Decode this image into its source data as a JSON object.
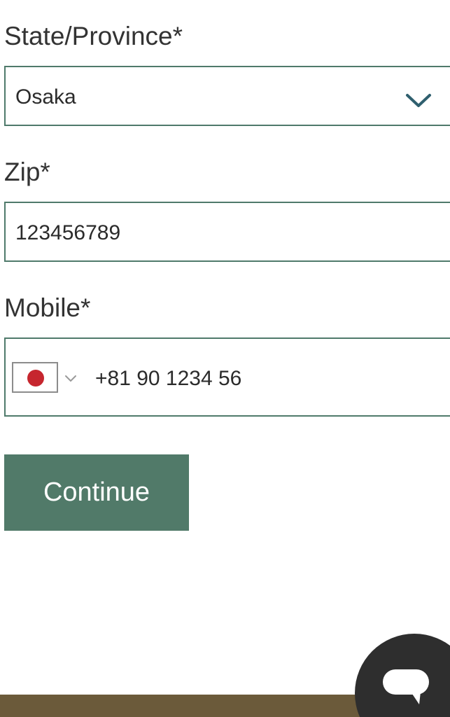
{
  "state": {
    "label": "State/Province*",
    "value": "Osaka"
  },
  "zip": {
    "label": "Zip*",
    "value": "123456789"
  },
  "mobile": {
    "label": "Mobile*",
    "value": "+81 90 1234 56",
    "country_flag": "japan-flag-icon"
  },
  "continue_label": "Continue",
  "colors": {
    "accent": "#517a69",
    "field_border": "#4f7a6b",
    "chevron": "#2f5f6e",
    "footer": "#6b5a3a",
    "chat_bubble": "#2e2e2e",
    "flag_red": "#c6262e"
  }
}
